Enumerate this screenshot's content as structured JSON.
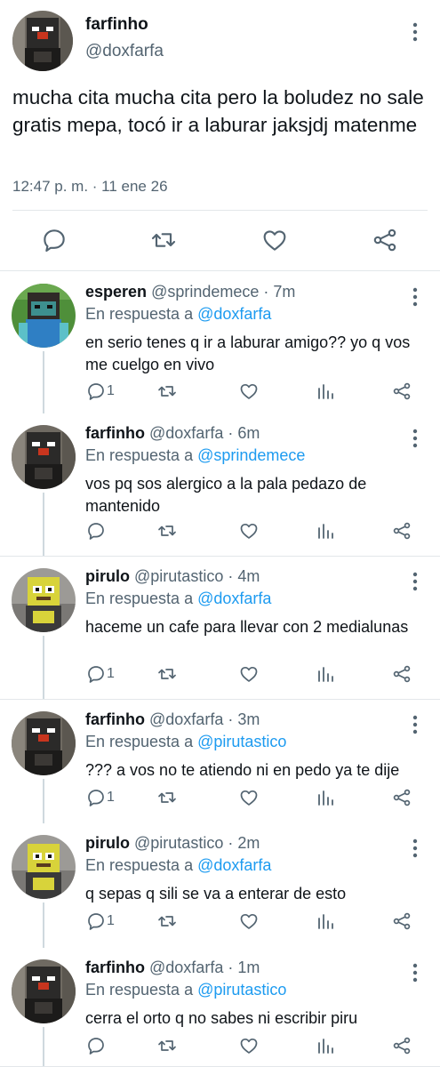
{
  "main_tweet": {
    "name": "farfinho",
    "handle": "@doxfarfa",
    "text": "mucha cita mucha cita pero la boludez no sale gratis mepa, tocó ir a laburar jaksjdj matenme",
    "timestamp": "12:47 p. m. · 11 ene 26",
    "actions": [
      "reply-icon",
      "retweet-icon",
      "like-icon",
      "share-icon"
    ]
  },
  "replies": [
    {
      "name": "esperen",
      "handle": "@sprindemece",
      "time": "7m",
      "reply_prefix": "En respuesta a",
      "reply_to": "@doxfarfa",
      "text": "en serio tenes q ir a laburar amigo?? yo q vos me cuelgo en vivo",
      "reply_count": "1"
    },
    {
      "name": "farfinho",
      "handle": "@doxfarfa",
      "time": "6m",
      "reply_prefix": "En respuesta a",
      "reply_to": "@sprindemece",
      "text": "vos pq sos alergico a la pala pedazo de mantenido",
      "reply_count": ""
    },
    {
      "name": "pirulo",
      "handle": "@pirutastico",
      "time": "4m",
      "reply_prefix": "En respuesta a",
      "reply_to": "@doxfarfa",
      "text": "haceme un cafe para llevar con 2 medialunas",
      "reply_count": "1"
    },
    {
      "name": "farfinho",
      "handle": "@doxfarfa",
      "time": "3m",
      "reply_prefix": "En respuesta a",
      "reply_to": "@pirutastico",
      "text": "??? a vos no te atiendo ni en pedo ya te dije",
      "reply_count": "1"
    },
    {
      "name": "pirulo",
      "handle": "@pirutastico",
      "time": "2m",
      "reply_prefix": "En respuesta a",
      "reply_to": "@doxfarfa",
      "text": "q sepas q sili se va a enterar de esto",
      "reply_count": "1"
    },
    {
      "name": "farfinho",
      "handle": "@doxfarfa",
      "time": "1m",
      "reply_prefix": "En respuesta a",
      "reply_to": "@pirutastico",
      "text": "cerra el orto q no sabes ni escribir piru",
      "reply_count": ""
    }
  ],
  "colors": {
    "accent": "#1d9bf0",
    "secondary_text": "#536471",
    "primary_text": "#0f1419",
    "divider": "#e3e7ea",
    "icon": "#536471"
  }
}
